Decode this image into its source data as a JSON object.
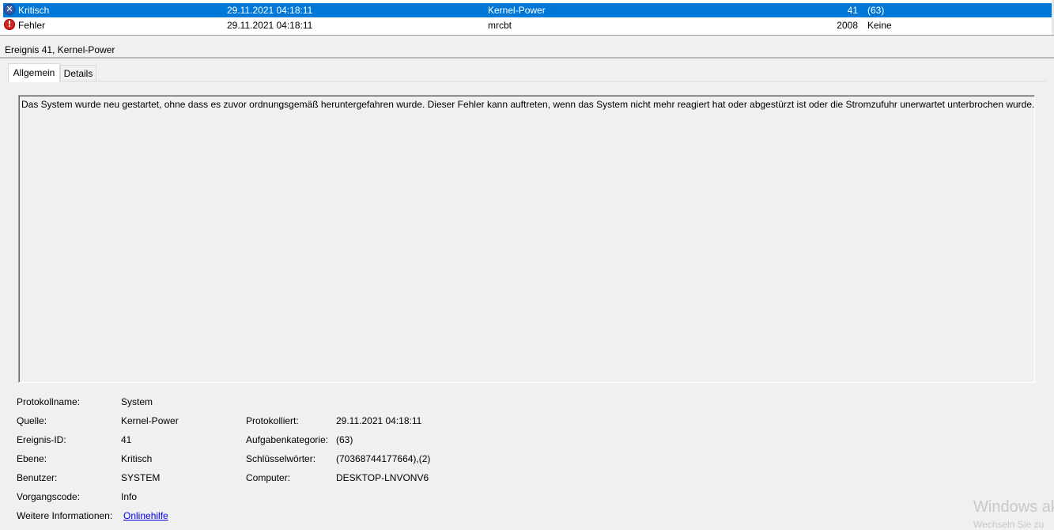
{
  "events": [
    {
      "level": "Kritisch",
      "date": "29.11.2021 04:18:11",
      "source": "Kernel-Power",
      "id": "41",
      "task": "(63)",
      "icon": "critical-icon",
      "selected": true
    },
    {
      "level": "Fehler",
      "date": "29.11.2021 04:18:11",
      "source": "mrcbt",
      "id": "2008",
      "task": "Keine",
      "icon": "error-icon",
      "selected": false
    }
  ],
  "detail": {
    "title": "Ereignis 41, Kernel-Power",
    "tabs": {
      "general": "Allgemein",
      "details": "Details"
    },
    "description": "Das System wurde neu gestartet, ohne dass es zuvor ordnungsgemäß heruntergefahren wurde. Dieser Fehler kann auftreten, wenn das System nicht mehr reagiert hat oder abgestürzt ist oder die Stromzufuhr unerwartet unterbrochen wurde.",
    "props": {
      "log_name_label": "Protokollname:",
      "log_name": "System",
      "source_label": "Quelle:",
      "source": "Kernel-Power",
      "logged_label": "Protokolliert:",
      "logged": "29.11.2021 04:18:11",
      "event_id_label": "Ereignis-ID:",
      "event_id": "41",
      "task_label": "Aufgabenkategorie:",
      "task": "(63)",
      "level_label": "Ebene:",
      "level": "Kritisch",
      "keywords_label": "Schlüsselwörter:",
      "keywords": "(70368744177664),(2)",
      "user_label": "Benutzer:",
      "user": "SYSTEM",
      "computer_label": "Computer:",
      "computer": "DESKTOP-LNVONV6",
      "opcode_label": "Vorgangscode:",
      "opcode": "Info",
      "more_info_label": "Weitere Informationen:",
      "more_info_link": "Onlinehilfe"
    }
  },
  "watermark": {
    "line1": "Windows ak",
    "line2": "Wechseln Sie zu"
  },
  "colors": {
    "selection": "#0078d7",
    "critical": "#3b5ba8",
    "error": "#d82222",
    "link": "#0000ee"
  }
}
